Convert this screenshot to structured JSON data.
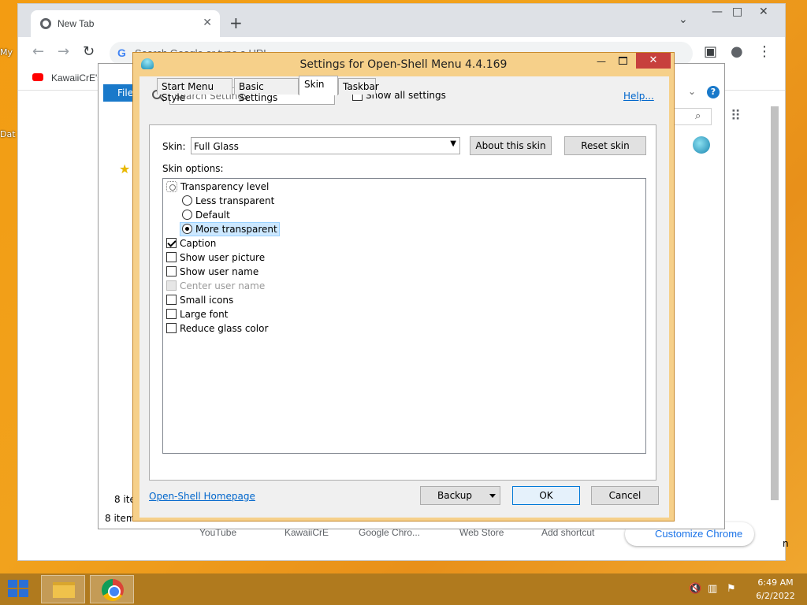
{
  "desktop": {
    "labels": [
      "My",
      "Dat"
    ]
  },
  "chrome": {
    "tab_title": "New Tab",
    "new_tab_symbol": "+",
    "tab_close_symbol": "✕",
    "omnibox_placeholder": "Search Google or type a URL",
    "google_g": "G",
    "bookmark_label": "KawaiiCrE's",
    "shortcuts": [
      "YouTube",
      "KawaiiCrE",
      "Google Chro...",
      "Web Store",
      "Add shortcut"
    ],
    "customize_label": "Customize Chrome",
    "edge_letter": "n"
  },
  "explorer": {
    "ribbon_file": "File",
    "status_items_partial": "8 ite",
    "status_items": "8 items",
    "help_symbol": "?"
  },
  "dialog": {
    "title": "Settings for Open-Shell Menu 4.4.169",
    "minimize_symbol": "—",
    "close_symbol": "✕",
    "search_placeholder": "Search Settings",
    "show_all_settings": "Show all settings",
    "show_all_checked": false,
    "help_link": "Help...",
    "tabs": [
      {
        "label": "Start Menu Style",
        "active": false
      },
      {
        "label": "Basic Settings",
        "active": false
      },
      {
        "label": "Skin",
        "active": true
      },
      {
        "label": "Taskbar",
        "active": false
      }
    ],
    "skin_label": "Skin:",
    "skin_value": "Full Glass",
    "select_arrow": "▼",
    "about_skin": "About this skin",
    "reset_skin": "Reset skin",
    "skin_options_label": "Skin options:",
    "options": {
      "transparency": "Transparency level",
      "less_transparent": "Less transparent",
      "default": "Default",
      "more_transparent": "More transparent",
      "caption": "Caption",
      "show_user_picture": "Show user picture",
      "show_user_name": "Show user name",
      "center_user_name": "Center user name",
      "small_icons": "Small icons",
      "large_font": "Large font",
      "reduce_glass_color": "Reduce glass color"
    },
    "selected_transparency": "More transparent",
    "checked": {
      "caption": true,
      "show_user_picture": false,
      "show_user_name": false,
      "center_user_name": false,
      "small_icons": false,
      "large_font": false,
      "reduce_glass_color": false
    },
    "homepage_link": "Open-Shell Homepage",
    "backup": "Backup",
    "ok": "OK",
    "cancel": "Cancel"
  },
  "taskbar": {
    "time": "6:49 AM",
    "date": "6/2/2022"
  },
  "colors": {
    "desktop_orange": "#f39c12",
    "dialog_frame": "#f6d08a",
    "link_blue": "#0066cc",
    "selection_blue": "#cce8ff"
  }
}
